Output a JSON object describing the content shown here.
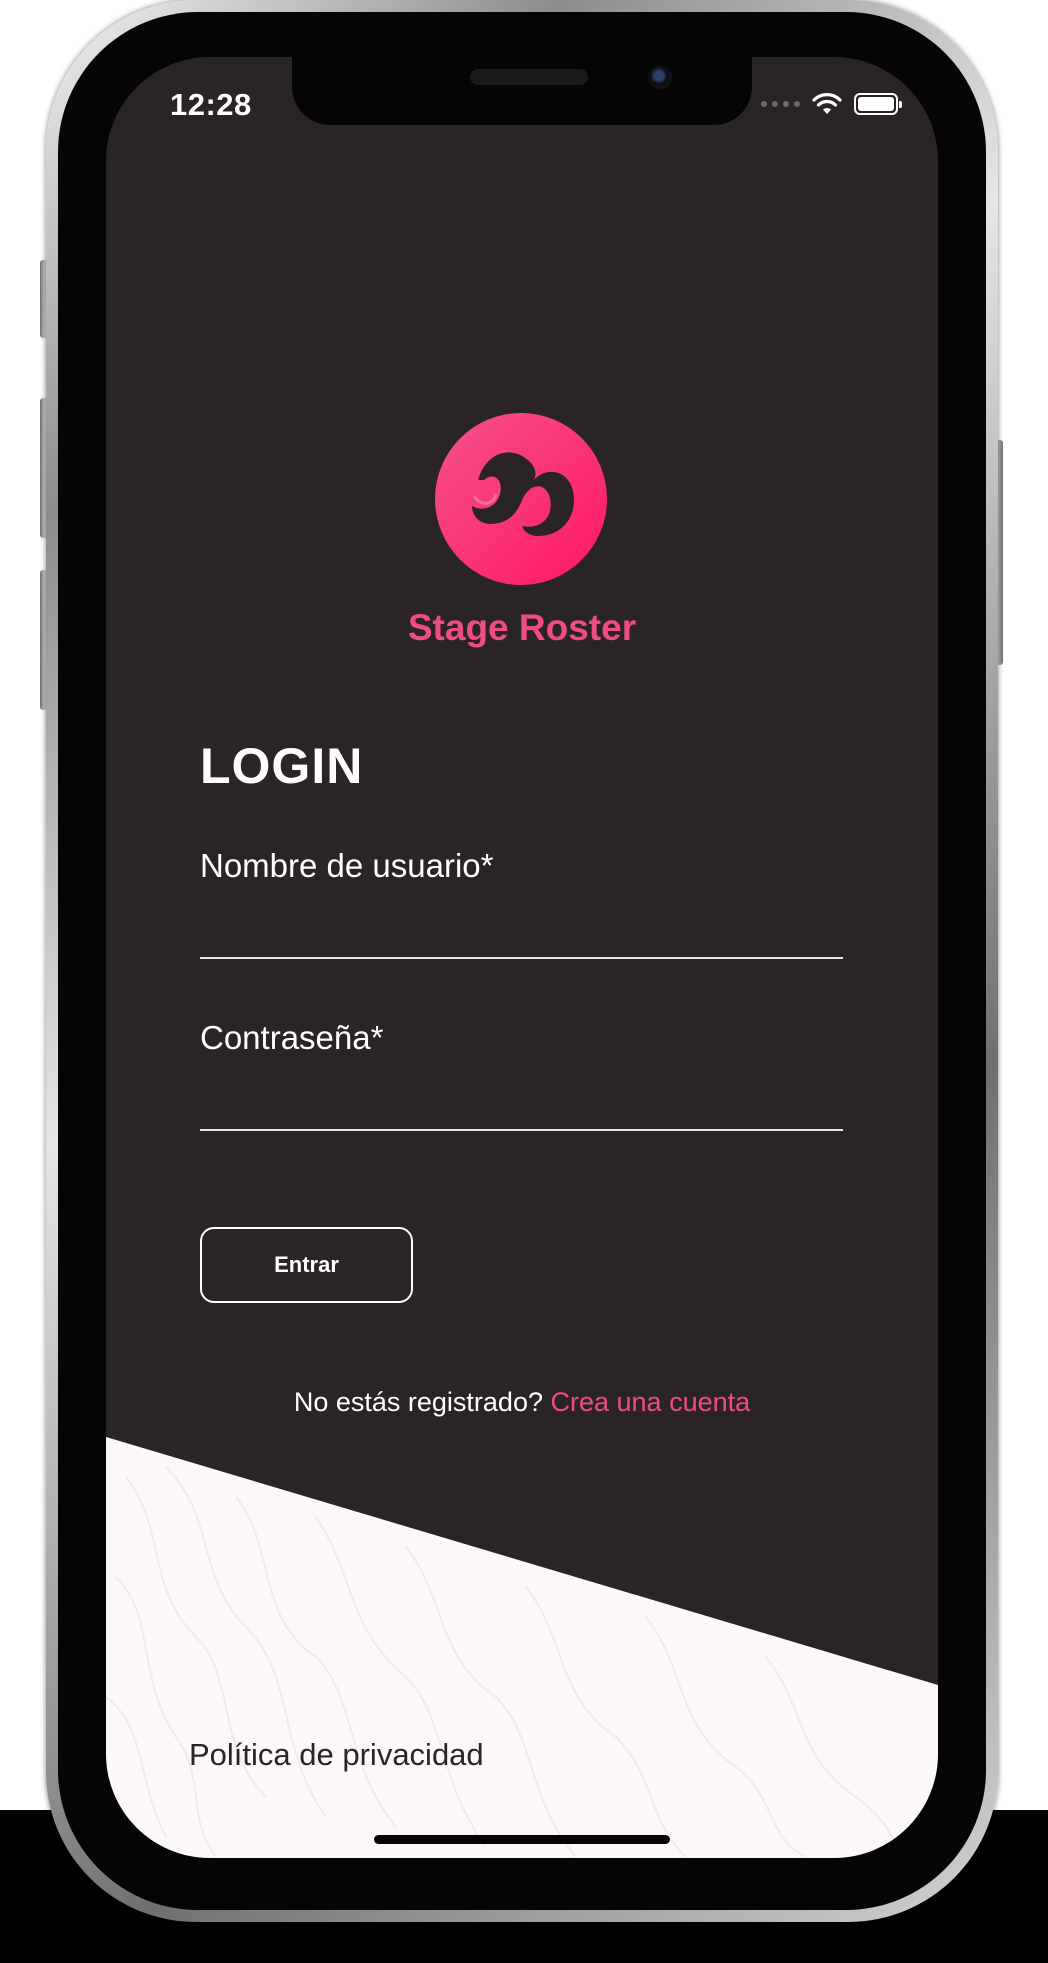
{
  "status_bar": {
    "time": "12:28",
    "battery_level": 1.0
  },
  "app": {
    "brand_name": "Stage Roster",
    "logo_icon": "stage-roster-logo",
    "accent_color": "#ef4c84",
    "background_color": "#2a2428"
  },
  "login": {
    "title": "LOGIN",
    "username_label": "Nombre de usuario*",
    "username_value": "",
    "password_label": "Contraseña*",
    "password_value": "",
    "submit_label": "Entrar",
    "register_prompt": "No estás registrado?",
    "register_link": "Crea una cuenta"
  },
  "footer": {
    "privacy_link": "Política de privacidad"
  }
}
